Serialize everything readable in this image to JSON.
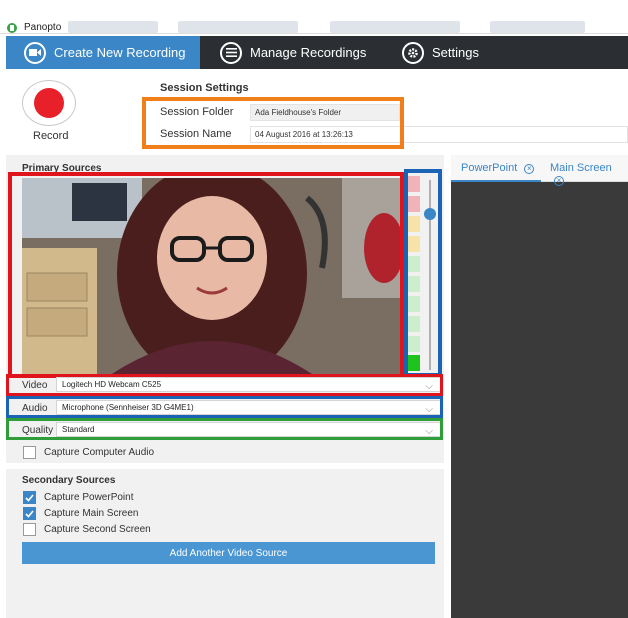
{
  "app": {
    "title": "Panopto"
  },
  "nav": {
    "tabs": [
      {
        "label": "Create New Recording",
        "icon": "video-camera-icon",
        "active": true
      },
      {
        "label": "Manage Recordings",
        "icon": "list-icon",
        "active": false
      },
      {
        "label": "Settings",
        "icon": "gear-icon",
        "active": false
      }
    ]
  },
  "record": {
    "label": "Record"
  },
  "session": {
    "heading": "Session Settings",
    "folder_label": "Session Folder",
    "folder_value": "Ada Fieldhouse's Folder",
    "name_label": "Session Name",
    "name_value": "04 August 2016 at 13:26:13"
  },
  "primary": {
    "title": "Primary Sources",
    "video_label": "Video",
    "video_value": "Logitech HD Webcam C525",
    "audio_label": "Audio",
    "audio_value": "Microphone (Sennheiser 3D G4ME1)",
    "quality_label": "Quality",
    "quality_value": "Standard",
    "capture_audio_label": "Capture Computer Audio",
    "capture_audio_checked": false
  },
  "secondary": {
    "title": "Secondary Sources",
    "options": [
      {
        "label": "Capture PowerPoint",
        "checked": true
      },
      {
        "label": "Capture Main Screen",
        "checked": true
      },
      {
        "label": "Capture Second Screen",
        "checked": false
      }
    ],
    "add_button": "Add Another Video Source"
  },
  "preview_tabs": [
    {
      "label": "PowerPoint"
    },
    {
      "label": "Main Screen"
    }
  ],
  "colors": {
    "accent": "#3b86c6",
    "nav_bg": "#2b2f33",
    "record_red": "#e8202a",
    "highlight_orange": "#f07f1a",
    "highlight_red": "#e0141c",
    "highlight_blue": "#1b64b5",
    "highlight_green": "#2f9e3a"
  }
}
